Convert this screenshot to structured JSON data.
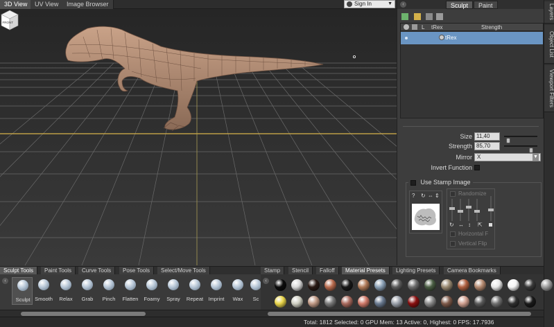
{
  "viewport_tabs": [
    "3D View",
    "UV View",
    "Image Browser"
  ],
  "signin": {
    "label": "Sign In"
  },
  "viewcube": {
    "label": "FRONT"
  },
  "right_panel": {
    "tabs": [
      "Sculpt",
      "Paint"
    ],
    "side_tabs": [
      "Layers",
      "Object List",
      "Viewport Filters"
    ],
    "object_list": {
      "headers": [
        "L",
        "tRex",
        "Strength"
      ],
      "rows": [
        {
          "name": "tRex"
        }
      ]
    },
    "properties": {
      "size": {
        "label": "Size",
        "value": "11,40",
        "level": 0.08
      },
      "strength": {
        "label": "Strength",
        "value": "85,70",
        "level": 0.86
      },
      "mirror": {
        "label": "Mirror",
        "value": "X"
      },
      "invert": {
        "label": "Invert Function"
      }
    },
    "stamp": {
      "label": "Use Stamp Image",
      "randomize": "Randomize",
      "horizontal_flip": "Horizontal F",
      "vertical_flip": "Vertical Flip"
    }
  },
  "bottom_tool_tabs": [
    "Sculpt Tools",
    "Paint Tools",
    "Curve Tools",
    "Pose Tools",
    "Select/Move Tools"
  ],
  "tools": [
    "Sculpt",
    "Smooth",
    "Relax",
    "Grab",
    "Pinch",
    "Flatten",
    "Foamy",
    "Spray",
    "Repeat",
    "Imprint",
    "Wax",
    "Sc"
  ],
  "palette_tabs": [
    "Stamp",
    "Stencil",
    "Falloff",
    "Material Presets",
    "Lighting Presets",
    "Camera Bookmarks"
  ],
  "material_row1": [
    "#0c0c0c",
    "#d9d9d9",
    "#2a1a14",
    "#b86b4e",
    "#181818",
    "#b07a58",
    "#8aa0b6",
    "#5c5c5c",
    "#6e6e6e",
    "#4b5e44",
    "#9a8a72",
    "#b06040",
    "#b58a70",
    "#e8e8e8",
    "#f5f5f5",
    "#3a3a3a",
    "#9e9e9e"
  ],
  "material_row2": [
    "#e8d44a",
    "#cfcfc2",
    "#c09a86",
    "#7a7a7a",
    "#a86a5e",
    "#d07a6a",
    "#6a7a90",
    "#9aa0aa",
    "#8a1010",
    "#8a8a8a",
    "#7e5a4a",
    "#d0a090",
    "#5a5a5a",
    "#707070",
    "#303030",
    "#1a1a1a"
  ],
  "status": "Total: 1812  Selected: 0 GPU Mem: 13  Active: 0, Highest: 0  FPS: 17.7936"
}
